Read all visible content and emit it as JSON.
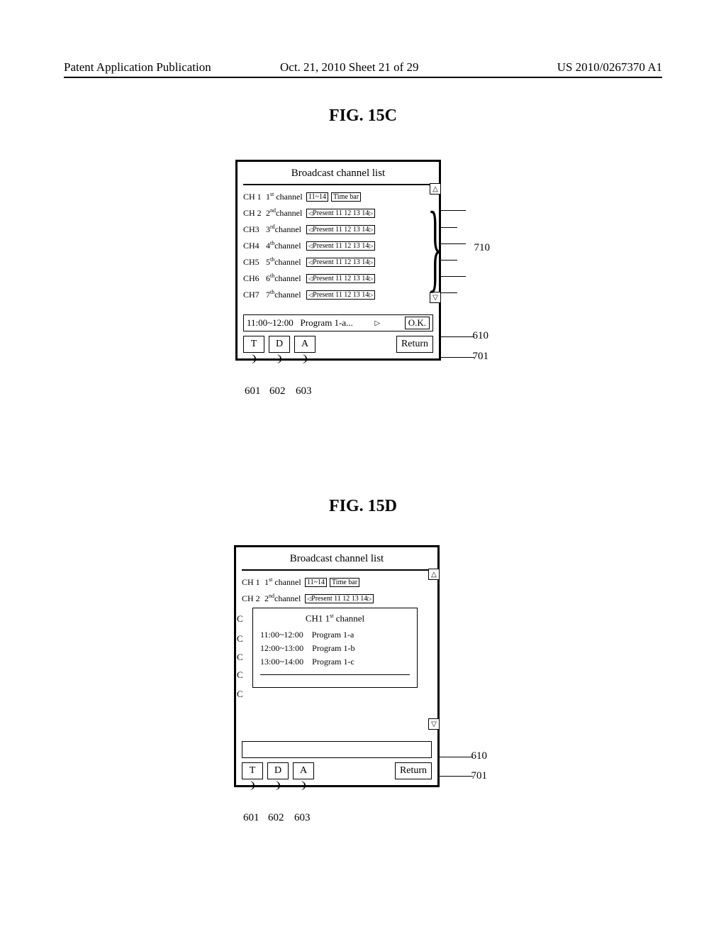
{
  "header": {
    "left": "Patent Application Publication",
    "center": "Oct. 21, 2010   Sheet 21 of 29",
    "right": "US 2010/0267370 A1"
  },
  "fig15c": {
    "label": "FIG. 15C",
    "title": "Broadcast channel list",
    "channels": [
      {
        "ch": "CH 1",
        "name": "1",
        "suffix": "st",
        "rest": "channel",
        "mode": "header",
        "range": "11~14",
        "bar": "Time bar"
      },
      {
        "ch": "CH 2",
        "name": "2",
        "suffix": "nd",
        "rest": "channel",
        "mode": "times",
        "present": "Present 11 12 13 14"
      },
      {
        "ch": "CH3",
        "name": "3",
        "suffix": "rd",
        "rest": "channel",
        "mode": "times",
        "present": "Present 11 12 13 14"
      },
      {
        "ch": "CH4",
        "name": "4",
        "suffix": "th",
        "rest": "channel",
        "mode": "times",
        "present": "Present 11 12 13 14"
      },
      {
        "ch": "CH5",
        "name": "5",
        "suffix": "th",
        "rest": "channel",
        "mode": "times",
        "present": "Present 11 12 13 14"
      },
      {
        "ch": "CH6",
        "name": "6",
        "suffix": "th",
        "rest": "channel",
        "mode": "times",
        "present": "Present 11 12 13 14"
      },
      {
        "ch": "CH7",
        "name": "7",
        "suffix": "th",
        "rest": "channel",
        "mode": "times",
        "present": "Present 11 12 13 14"
      }
    ],
    "info": {
      "time": "11:00~12:00",
      "prog": "Program 1-a...",
      "ok": "O.K."
    },
    "buttons": {
      "t": "T",
      "d": "D",
      "a": "A",
      "ret": "Return"
    },
    "refs": {
      "r601": "601",
      "r602": "602",
      "r603": "603",
      "r610": "610",
      "r701": "701",
      "r710": "710"
    }
  },
  "fig15d": {
    "label": "FIG. 15D",
    "title": "Broadcast channel list",
    "channels": [
      {
        "ch": "CH 1",
        "name": "1",
        "suffix": "st",
        "rest": "channel",
        "mode": "header",
        "range": "11~14",
        "bar": "Time bar"
      },
      {
        "ch": "CH 2",
        "name": "2",
        "suffix": "nd",
        "rest": "channel",
        "mode": "times",
        "present": "Present 11 12 13 14"
      }
    ],
    "popup": {
      "title_ch": "CH1  1",
      "title_suffix": "st",
      "title_rest": " channel",
      "rows": [
        {
          "time": "11:00~12:00",
          "prog": "Program 1-a"
        },
        {
          "time": "12:00~13:00",
          "prog": "Program 1-b"
        },
        {
          "time": "13:00~14:00",
          "prog": "Program 1-c"
        }
      ]
    },
    "c_edges": {
      "c": "C"
    },
    "buttons": {
      "t": "T",
      "d": "D",
      "a": "A",
      "ret": "Return"
    },
    "refs": {
      "r601": "601",
      "r602": "602",
      "r603": "603",
      "r610": "610",
      "r701": "701"
    }
  }
}
